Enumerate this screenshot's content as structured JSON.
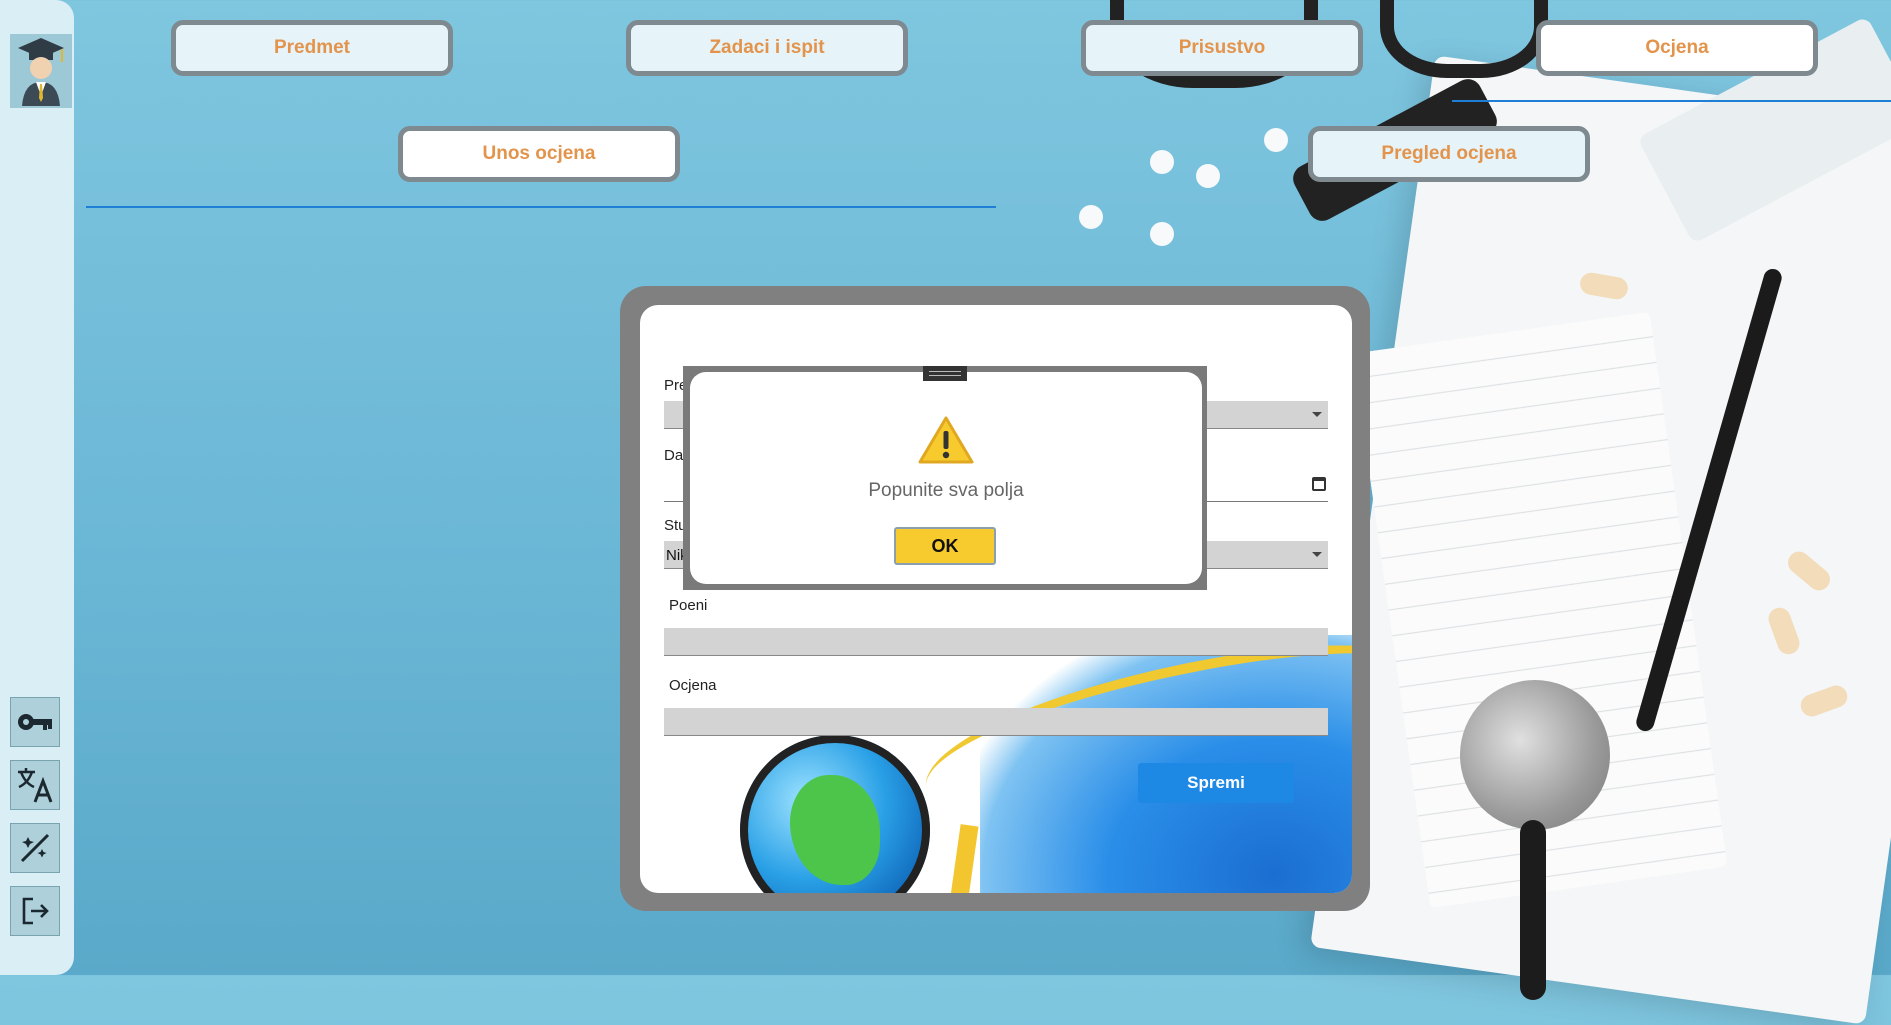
{
  "tabs": {
    "row1": [
      {
        "label": "Predmet",
        "active": false
      },
      {
        "label": "Zadaci i ispit",
        "active": false
      },
      {
        "label": "Prisustvo",
        "active": false
      },
      {
        "label": "Ocjena",
        "active": true
      }
    ],
    "row2": [
      {
        "label": "Unos ocjena",
        "active": true
      },
      {
        "label": "Pregled ocjena",
        "active": false
      }
    ]
  },
  "sidebar": {
    "avatar_icon": "graduate-avatar-icon",
    "buttons": [
      {
        "icon": "key-icon"
      },
      {
        "icon": "translate-icon"
      },
      {
        "icon": "theme-toggle-icon"
      },
      {
        "icon": "logout-icon"
      }
    ]
  },
  "form": {
    "subject_label_visible": "Pre",
    "date_label_visible": "Da",
    "student_label_visible": "Stu",
    "student_value_visible": "Nik",
    "points_label": "Poeni",
    "points_value": "",
    "grade_label": "Ocjena",
    "grade_value": "",
    "save_label": "Spremi"
  },
  "dialog": {
    "icon": "warning-icon",
    "message": "Popunite sva polja",
    "ok_label": "OK"
  },
  "colors": {
    "tab_text": "#e3944c",
    "accent_blue": "#1e88e5",
    "ok_yellow": "#f7cb2e",
    "underline": "#1f7fd6"
  }
}
